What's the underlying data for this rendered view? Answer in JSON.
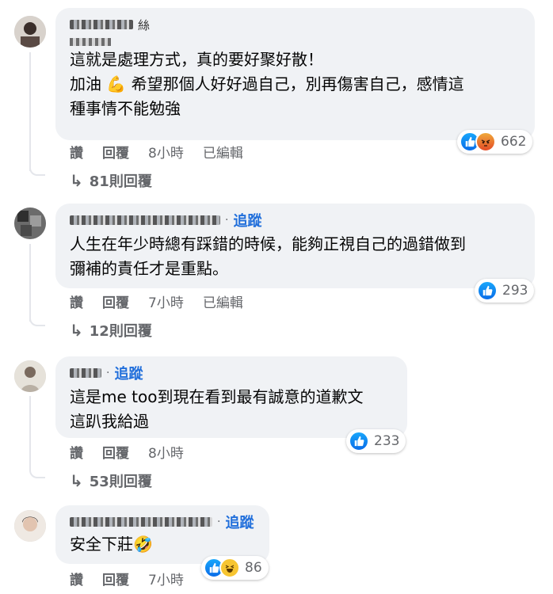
{
  "comments": [
    {
      "follow": "",
      "name_suffix": "絲",
      "text": "這就是處理方式，真的要好聚好散！\n加油 💪 希望那個人好好過自己，別再傷害自己，感情這\n種事情不能勉強",
      "reactions": [
        "like-icon",
        "angry-icon"
      ],
      "count": "662",
      "actions": {
        "like": "讚",
        "reply": "回覆",
        "time": "8小時",
        "edited": "已編輯"
      },
      "replies": "81則回覆"
    },
    {
      "follow": "追蹤",
      "text": "人生在年少時總有踩錯的時候，能夠正視自己的過錯做到\n彌補的責任才是重點。",
      "reactions": [
        "like-icon"
      ],
      "count": "293",
      "actions": {
        "like": "讚",
        "reply": "回覆",
        "time": "7小時",
        "edited": "已編輯"
      },
      "replies": "12則回覆"
    },
    {
      "follow": "追蹤",
      "text": "這是me too到現在看到最有誠意的道歉文\n這趴我給過",
      "reactions": [
        "like-icon"
      ],
      "count": "233",
      "actions": {
        "like": "讚",
        "reply": "回覆",
        "time": "8小時"
      },
      "replies": "53則回覆"
    },
    {
      "follow": "追蹤",
      "text": "安全下莊🤣",
      "reactions": [
        "like-icon",
        "haha-icon"
      ],
      "count": "86",
      "actions": {
        "like": "讚",
        "reply": "回覆",
        "time": "7小時"
      }
    }
  ]
}
